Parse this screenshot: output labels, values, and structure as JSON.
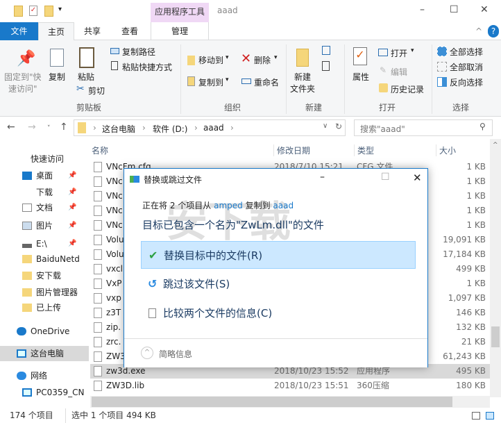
{
  "window": {
    "title": "aaad",
    "context_tab": "应用程序工具",
    "minimize": "–",
    "maximize": "☐",
    "close": "✕"
  },
  "tabs": [
    {
      "label": "文件"
    },
    {
      "label": "主页"
    },
    {
      "label": "共享"
    },
    {
      "label": "查看"
    },
    {
      "label": "管理"
    }
  ],
  "ribbon": {
    "clipboard": {
      "pin": "固定到\"快",
      "pin2": "速访问\"",
      "copy": "复制",
      "paste": "粘贴",
      "copy_path": "复制路径",
      "paste_shortcut": "粘贴快捷方式",
      "cut": "剪切",
      "group": "剪贴板"
    },
    "organize": {
      "move_to": "移动到",
      "copy_to": "复制到",
      "delete": "删除",
      "rename": "重命名",
      "group": "组织"
    },
    "new": {
      "new_folder": "新建",
      "new_folder2": "文件夹",
      "group": "新建"
    },
    "open": {
      "properties": "属性",
      "open": "打开",
      "edit": "编辑",
      "history": "历史记录",
      "group": "打开"
    },
    "select": {
      "select_all": "全部选择",
      "select_none": "全部取消",
      "invert": "反向选择",
      "group": "选择"
    }
  },
  "address": {
    "crumbs": [
      "这台电脑",
      "软件 (D:)",
      "aaad"
    ],
    "search_placeholder": "搜索\"aaad\""
  },
  "sidebar": [
    {
      "label": "快速访问",
      "icon": "star-icon"
    },
    {
      "label": "桌面",
      "icon": "desktop-icon",
      "pinned": true
    },
    {
      "label": "下载",
      "icon": "download-icon",
      "pinned": true
    },
    {
      "label": "文档",
      "icon": "document-icon",
      "pinned": true
    },
    {
      "label": "图片",
      "icon": "picture-icon",
      "pinned": true
    },
    {
      "label": "E:\\",
      "icon": "drive-icon",
      "pinned": true
    },
    {
      "label": "BaiduNetd",
      "icon": "folder-icon"
    },
    {
      "label": "安下载",
      "icon": "folder-icon"
    },
    {
      "label": "图片管理器",
      "icon": "folder-icon"
    },
    {
      "label": "已上传",
      "icon": "folder-icon"
    },
    {
      "label": "OneDrive",
      "icon": "cloud-icon"
    },
    {
      "label": "这台电脑",
      "icon": "computer-icon",
      "selected": true
    },
    {
      "label": "网络",
      "icon": "network-icon"
    },
    {
      "label": "PC0359_CN",
      "icon": "computer-icon"
    }
  ],
  "columns": {
    "name": "名称",
    "date": "修改日期",
    "type": "类型",
    "size": "大小"
  },
  "files": [
    {
      "name": "VNcFm.cfg",
      "date": "2018/7/10 15:21",
      "type": "CFG 文件",
      "size": "1 KB"
    },
    {
      "name": "VNc",
      "date": "",
      "type": "",
      "size": "1 KB"
    },
    {
      "name": "VNc",
      "date": "",
      "type": "",
      "size": "1 KB"
    },
    {
      "name": "VNc",
      "date": "",
      "type": "",
      "size": "1 KB"
    },
    {
      "name": "VNc",
      "date": "",
      "type": "",
      "size": "1 KB"
    },
    {
      "name": "Volu",
      "date": "",
      "type": "",
      "size": "19,091 KB"
    },
    {
      "name": "Volu",
      "date": "",
      "type": "",
      "size": "17,184 KB"
    },
    {
      "name": "vxcl",
      "date": "",
      "type": "",
      "size": "499 KB"
    },
    {
      "name": "VxP",
      "date": "",
      "type": "",
      "size": "1 KB"
    },
    {
      "name": "vxp",
      "date": "",
      "type": "",
      "size": "1,097 KB"
    },
    {
      "name": "z3T",
      "date": "",
      "type": "",
      "size": "146 KB"
    },
    {
      "name": "zip.",
      "date": "",
      "type": "",
      "size": "132 KB"
    },
    {
      "name": "zrc.",
      "date": "",
      "type": "",
      "size": "21 KB"
    },
    {
      "name": "ZW3",
      "date": "",
      "type": "",
      "size": "61,243 KB"
    },
    {
      "name": "zw3d.exe",
      "date": "2018/10/23 15:52",
      "type": "应用程序",
      "size": "495 KB",
      "selected": true
    },
    {
      "name": "ZW3D.lib",
      "date": "2018/10/23 15:51",
      "type": "360压缩",
      "size": "180 KB"
    }
  ],
  "status": {
    "count": "174 个项目",
    "selected": "选中 1 个项目  494 KB"
  },
  "dialog": {
    "title": "替换或跳过文件",
    "progress_prefix": "正在将 2 个项目从 ",
    "source": "amped",
    "mid": " 复制到 ",
    "dest": "aaad",
    "message": "目标已包含一个名为\"ZwLm.dll\"的文件",
    "options": [
      "替换目标中的文件(R)",
      "跳过该文件(S)",
      "比较两个文件的信息(C)"
    ],
    "details": "简略信息",
    "watermark": "安下载 anxz.com"
  },
  "colors": {
    "accent": "#1979ca",
    "selection": "#cce8ff",
    "context_tab": "#f0d8f5"
  }
}
